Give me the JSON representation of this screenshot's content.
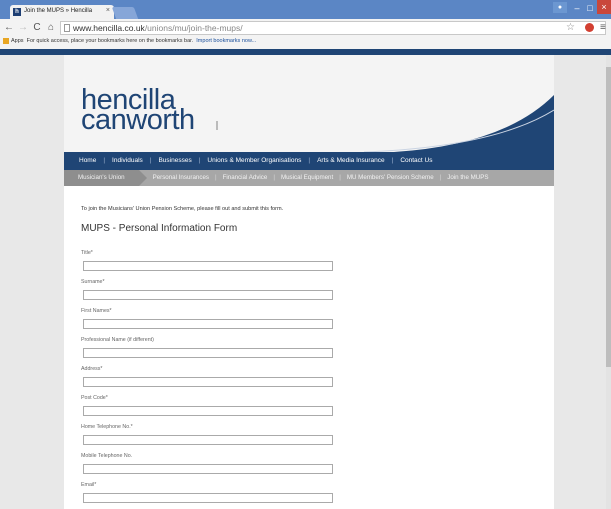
{
  "browser": {
    "tab_title": "Join the MUPS » Hencilla",
    "tab_close": "×",
    "favicon_letter": "h",
    "url_domain": "www.hencilla.co.uk",
    "url_path": "/unions/mu/join-the-mups/",
    "bookmarks_apps": "Apps",
    "bookmarks_text": "For quick access, place your bookmarks here on the bookmarks bar.",
    "bookmarks_import": "Import bookmarks now...",
    "icons": [
      "back-arrow-icon",
      "forward-arrow-icon",
      "reload-icon",
      "home-icon",
      "page-icon",
      "star-icon",
      "menu-icon"
    ]
  },
  "site": {
    "logo_line1": "hencilla",
    "logo_line2": "canworth",
    "brand_color": "#1f4575",
    "main_nav": [
      "Home",
      "Individuals",
      "Businesses",
      "Unions & Member Organisations",
      "Arts & Media Insurance",
      "Contact Us"
    ],
    "sub_nav_active": "Musician's Union",
    "sub_nav": [
      "Personal Insurances",
      "Financial Advice",
      "Musical Equipment",
      "MU Members' Pension Scheme",
      "Join the MUPS"
    ]
  },
  "form": {
    "intro": "To join the Musicians' Union Pension Scheme, please fill out and submit this form.",
    "title": "MUPS - Personal Information Form",
    "fields": [
      {
        "label": "Title*",
        "value": ""
      },
      {
        "label": "Surname*",
        "value": ""
      },
      {
        "label": "First Names*",
        "value": ""
      },
      {
        "label": "Professional Name (if different)",
        "value": ""
      },
      {
        "label": "Address*",
        "value": ""
      },
      {
        "label": "Post Code*",
        "value": ""
      },
      {
        "label": "Home Telephone No.*",
        "value": ""
      },
      {
        "label": "Mobile Telephone No.",
        "value": ""
      },
      {
        "label": "Email*",
        "value": ""
      }
    ]
  }
}
